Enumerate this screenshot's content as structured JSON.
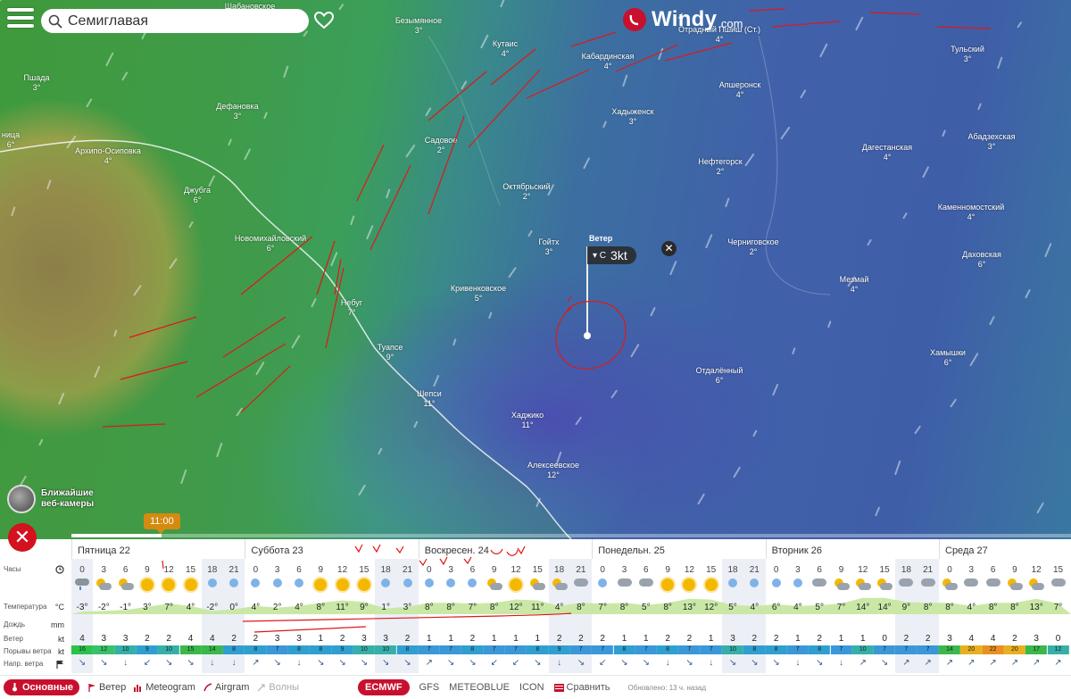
{
  "search": {
    "value": "Семиглавая"
  },
  "logo": {
    "name": "Windy",
    "domain": ".com"
  },
  "places": [
    {
      "name": "Шабановское",
      "temp": ""
    },
    {
      "name": "Безымянное",
      "temp": "3°"
    },
    {
      "name": "Кутаис",
      "temp": "4°"
    },
    {
      "name": "Кабардинская",
      "temp": "4°"
    },
    {
      "name": "Отрадный Пшиш (Ст.)",
      "temp": "4°"
    },
    {
      "name": "Тульский",
      "temp": "3°"
    },
    {
      "name": "Пшада",
      "temp": "3°"
    },
    {
      "name": "Дефановка",
      "temp": "3°"
    },
    {
      "name": "Апшеронск",
      "temp": "4°"
    },
    {
      "name": "Хадыженск",
      "temp": "3°"
    },
    {
      "name": "Абадзехская",
      "temp": "3°"
    },
    {
      "name": "Садовое",
      "temp": "2°"
    },
    {
      "name": "Дагестанская",
      "temp": "4°"
    },
    {
      "name": "Архипо-Осиповка",
      "temp": "4°"
    },
    {
      "name": "Нефтегорск",
      "temp": "2°"
    },
    {
      "name": "Джубга",
      "temp": "6°"
    },
    {
      "name": "Октябрьский",
      "temp": "2°"
    },
    {
      "name": "Каменномостский",
      "temp": "4°"
    },
    {
      "name": "Новомихайловский",
      "temp": "6°"
    },
    {
      "name": "Гойтх",
      "temp": "3°"
    },
    {
      "name": "Черниговское",
      "temp": "2°"
    },
    {
      "name": "Даховская",
      "temp": "6°"
    },
    {
      "name": "Кривенковское",
      "temp": "5°"
    },
    {
      "name": "Мезмай",
      "temp": "4°"
    },
    {
      "name": "Небуг",
      "temp": "7°"
    },
    {
      "name": "Туапсе",
      "temp": "9°"
    },
    {
      "name": "Хамышки",
      "temp": "6°"
    },
    {
      "name": "Отдалённый",
      "temp": "6°"
    },
    {
      "name": "Шепси",
      "temp": "11°"
    },
    {
      "name": "Хаджико",
      "temp": "11°"
    },
    {
      "name": "Алексеевское",
      "temp": "12°"
    },
    {
      "name": "ница",
      "temp": "6°"
    }
  ],
  "popup": {
    "title": "Ветер",
    "direction": "▾ С",
    "value": "3kt",
    "close": "✕"
  },
  "webcams": {
    "label": "Ближайшие веб-камеры"
  },
  "timeline": {
    "time": "11:00",
    "progress_pct": 9
  },
  "forecast": {
    "days": [
      "Пятница 22",
      "Суббота 23",
      "Воскресен. 24",
      "Понедельн. 25",
      "Вторник 26",
      "Среда 27"
    ],
    "row_labels": {
      "hours": "Часы",
      "temperature": "Температура",
      "temperature_unit": "°C",
      "rain": "Дождь",
      "rain_unit": "mm",
      "wind": "Ветер",
      "wind_unit": "kt",
      "gusts": "Порывы ветра",
      "gusts_unit": "kt",
      "direction": "Напр. ветра"
    },
    "hours": [
      "0",
      "3",
      "6",
      "9",
      "12",
      "15",
      "18",
      "21",
      "0",
      "3",
      "6",
      "9",
      "12",
      "15",
      "18",
      "21",
      "0",
      "3",
      "6",
      "9",
      "12",
      "15",
      "18",
      "21",
      "0",
      "3",
      "6",
      "9",
      "12",
      "15",
      "18",
      "21",
      "0",
      "3",
      "6",
      "9",
      "12",
      "15",
      "18",
      "21",
      "0",
      "3",
      "6",
      "9",
      "12",
      "15"
    ],
    "icons": [
      "rain",
      "pcloud",
      "pcloud",
      "sun",
      "sun",
      "sun",
      "moon",
      "moon",
      "moon",
      "moon",
      "moon",
      "sun",
      "sun",
      "sun",
      "moon",
      "moon",
      "moon",
      "moon",
      "moon",
      "pcloud",
      "sun",
      "pcloud",
      "pcloud",
      "cloud",
      "moon",
      "cloud",
      "cloud",
      "sun",
      "sun",
      "sun",
      "moon",
      "moon",
      "moon",
      "moon",
      "cloud",
      "pcloud",
      "pcloud",
      "pcloud",
      "cloud",
      "cloud",
      "pcloud",
      "cloud",
      "cloud",
      "pcloud",
      "pcloud",
      "cloud"
    ],
    "temps": [
      "-3°",
      "-2°",
      "-1°",
      "3°",
      "7°",
      "4°",
      "-2°",
      "0°",
      "4°",
      "2°",
      "4°",
      "8°",
      "11°",
      "9°",
      "1°",
      "3°",
      "8°",
      "8°",
      "7°",
      "8°",
      "12°",
      "11°",
      "4°",
      "8°",
      "7°",
      "8°",
      "5°",
      "8°",
      "13°",
      "12°",
      "5°",
      "4°",
      "6°",
      "4°",
      "5°",
      "7°",
      "14°",
      "14°",
      "9°",
      "8°",
      "8°",
      "4°",
      "8°",
      "8°",
      "13°",
      "7°"
    ],
    "wind": [
      "4",
      "3",
      "3",
      "2",
      "2",
      "4",
      "4",
      "2",
      "2",
      "3",
      "3",
      "1",
      "2",
      "3",
      "3",
      "2",
      "1",
      "1",
      "2",
      "1",
      "1",
      "1",
      "2",
      "2",
      "2",
      "1",
      "1",
      "2",
      "2",
      "1",
      "3",
      "2",
      "2",
      "1",
      "2",
      "1",
      "1",
      "0",
      "2",
      "2",
      "3",
      "4",
      "4",
      "2",
      "3",
      "0"
    ],
    "gusts": [
      "16",
      "12",
      "10",
      "9",
      "10",
      "15",
      "14",
      "8",
      "8",
      "7",
      "8",
      "8",
      "9",
      "10",
      "10",
      "8",
      "7",
      "7",
      "8",
      "7",
      "7",
      "8",
      "9",
      "7",
      "7",
      "8",
      "7",
      "8",
      "7",
      "7",
      "10",
      "8",
      "8",
      "7",
      "8",
      "7",
      "10",
      "7",
      "7",
      "7",
      "14",
      "20",
      "22",
      "20",
      "17",
      "12"
    ],
    "gust_colors": [
      "#2bc24a",
      "#38c06a",
      "#35b0a8",
      "#2f9fd0",
      "#35b0a8",
      "#3ab84a",
      "#3ab84a",
      "#2f9fd0",
      "#2f9fd0",
      "#3a98d8",
      "#2f9fd0",
      "#2f9fd0",
      "#2f9fd0",
      "#35b0a8",
      "#35b0a8",
      "#2f9fd0",
      "#3a98d8",
      "#3a98d8",
      "#2f9fd0",
      "#3a98d8",
      "#3a98d8",
      "#2f9fd0",
      "#2f9fd0",
      "#3a98d8",
      "#3a98d8",
      "#2f9fd0",
      "#3a98d8",
      "#2f9fd0",
      "#3a98d8",
      "#3a98d8",
      "#35b0a8",
      "#2f9fd0",
      "#2f9fd0",
      "#3a98d8",
      "#2f9fd0",
      "#3a98d8",
      "#35b0a8",
      "#3a98d8",
      "#3a98d8",
      "#3a98d8",
      "#3ab84a",
      "#e8b020",
      "#e89020",
      "#e8b020",
      "#3ab84a",
      "#35b0a8"
    ],
    "directions": [
      "↘",
      "↘",
      "↓",
      "↙",
      "↘",
      "↘",
      "↓",
      "↓",
      "↗",
      "↘",
      "↓",
      "↘",
      "↘",
      "↘",
      "↘",
      "↘",
      "↗",
      "↘",
      "↘",
      "↙",
      "↙",
      "↘",
      "↓",
      "↘",
      "↙",
      "↘",
      "↘",
      "↓",
      "↘",
      "↓",
      "↘",
      "↘",
      "↘",
      "↓",
      "↘",
      "↓",
      "↗",
      "↘",
      "↗",
      "↗",
      "↗",
      "↗",
      "↗",
      "↗",
      "↗",
      "↗"
    ]
  },
  "bottombar": {
    "tabs": [
      {
        "label": "Основные",
        "active": true
      },
      {
        "label": "Ветер"
      },
      {
        "label": "Meteogram"
      },
      {
        "label": "Airgram"
      },
      {
        "label": "Волны",
        "disabled": true
      }
    ],
    "models": [
      "ECMWF",
      "GFS",
      "METEOBLUE",
      "ICON"
    ],
    "compare": "Сравнить",
    "updated": "Обновлено: 13 ч. назад"
  }
}
